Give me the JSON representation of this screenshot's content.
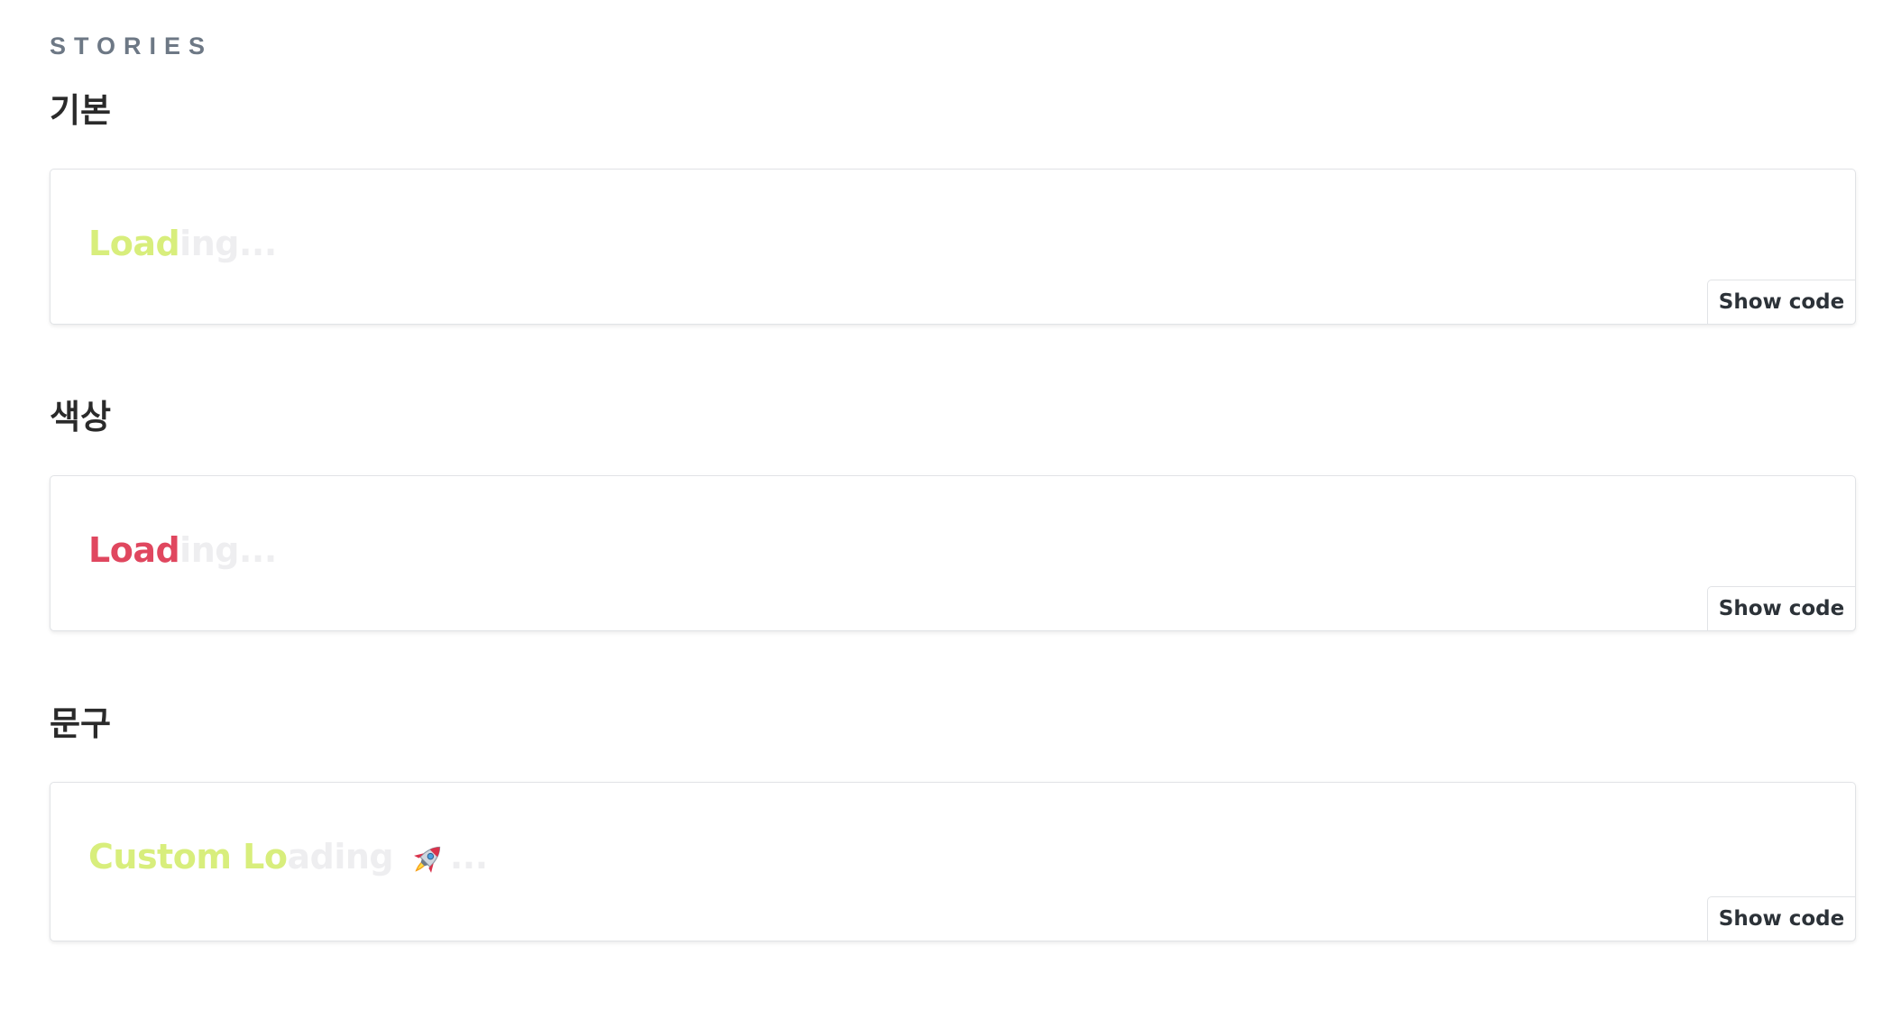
{
  "header": {
    "section_label": "STORIES"
  },
  "stories": [
    {
      "title": "기본",
      "loading_filled": "Load",
      "loading_ghost": "ing...",
      "accent_color": "#d8ee7c",
      "show_code_label": "Show code"
    },
    {
      "title": "색상",
      "loading_filled": "Load",
      "loading_ghost": "ing...",
      "accent_color": "#e0475f",
      "show_code_label": "Show code"
    },
    {
      "title": "문구",
      "loading_filled": "Custom Lo",
      "loading_ghost": "ading ",
      "loading_tail": "...",
      "icon": "rocket-icon",
      "accent_color": "#d8ee7c",
      "show_code_label": "Show code"
    }
  ],
  "colors": {
    "ghost_text": "#eeeef0",
    "heading": "#2a2a2a",
    "section_label": "#6d7885"
  }
}
